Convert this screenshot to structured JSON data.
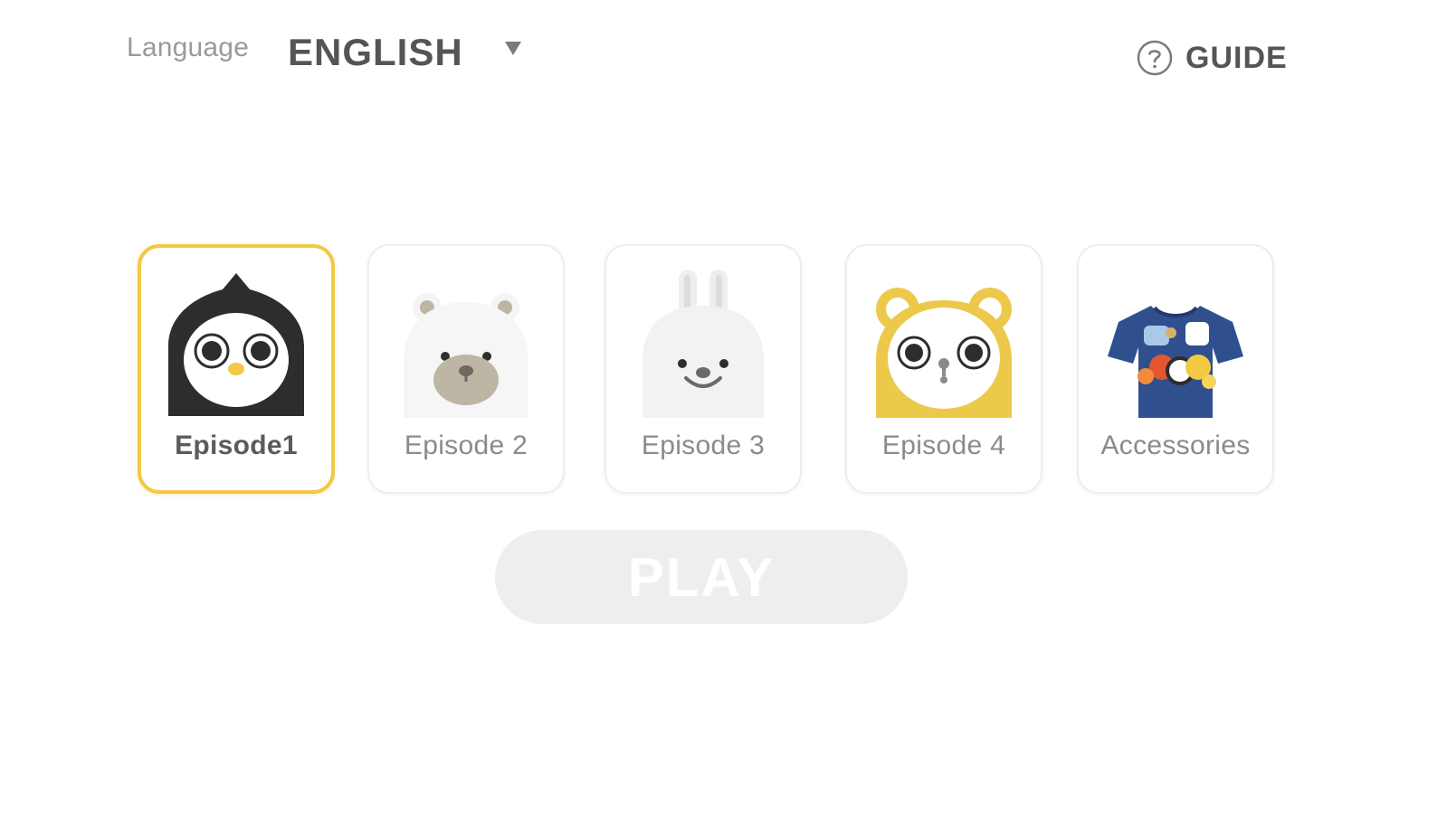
{
  "header": {
    "language_label": "Language",
    "language_value": "ENGLISH",
    "guide_label": "GUIDE"
  },
  "episodes": [
    {
      "label": "Episode1",
      "character": "penguin-icon",
      "selected": true
    },
    {
      "label": "Episode 2",
      "character": "polar-bear-icon",
      "selected": false
    },
    {
      "label": "Episode 3",
      "character": "rabbit-icon",
      "selected": false
    },
    {
      "label": "Episode 4",
      "character": "yellow-bear-icon",
      "selected": false
    },
    {
      "label": "Accessories",
      "character": "tshirt-icon",
      "selected": false
    }
  ],
  "play": {
    "label": "PLAY",
    "enabled": false
  },
  "colors": {
    "accent": "#f3c944",
    "text_dark": "#555555",
    "text_muted": "#8b8b8b",
    "play_disabled_bg": "#eeeeee",
    "tshirt_blue": "#2f4f8f"
  }
}
